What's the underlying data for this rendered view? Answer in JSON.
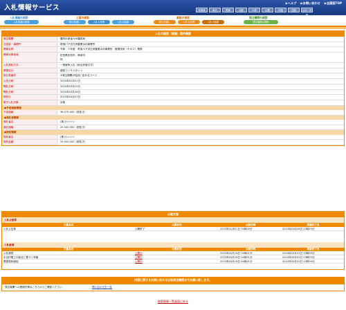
{
  "header": {
    "title": "入札情報サービス",
    "links": [
      "▶ヘルプ",
      "▶お問い合わせ",
      "▶全国版TOP"
    ],
    "regions": [
      "北海道",
      "東北",
      "関東",
      "北陸",
      "中部",
      "近畿",
      "中国",
      "四国",
      "九州・沖縄"
    ]
  },
  "nav": {
    "group_search": "入札情報の検索",
    "group_search_tab": "入札情報の検索",
    "group_work": "工事の検索",
    "work_tabs": [
      "発注見通し",
      "入札公告等",
      "入札の結果"
    ],
    "group_service": "業務の検索",
    "service_tabs": [
      "発注見通し",
      "入札公告等",
      "入札の結果"
    ],
    "group_org": "発注機関の検索",
    "org_tab": "発注機関の検索"
  },
  "detail": {
    "title": "入札の経過（業務）案件概要",
    "rows": [
      {
        "label": "発注機関",
        "value": "農林水産省九州農政局"
      },
      {
        "label": "当該部・事務所",
        "value": "筑後川下流左岸農業水利事業所"
      },
      {
        "label": "業務名称",
        "value": "令和　５年度　筑後川下流左岸農業水利事業所　管理技術（その２）業務"
      },
      {
        "label": "業務対象地域",
        "value": "佐賀県佐賀市、神埼市\n他"
      },
      {
        "label": "入札契約方式",
        "value": "一般競争入札（総合評価方式）"
      },
      {
        "label": "業務区分",
        "value": "建設コンサルタント"
      },
      {
        "label": "設計書番号",
        "value": "※発注機関が独自に定めるコード"
      },
      {
        "label": "公告日時",
        "value": "2023年02月01日"
      },
      {
        "label": "開札日時",
        "value": "2023年03月20日"
      },
      {
        "label": "開札日時",
        "value": "2023年03月28日"
      },
      {
        "label": "契約日",
        "value": "2023年04月07日"
      },
      {
        "label": "電子入札対象",
        "value": "対象"
      }
    ],
    "sec_price": "●予定価格情報",
    "price_label": "予定価格",
    "price_value": "36,070,000（税抜き）",
    "sec_winner": "●落札者情報",
    "winner_name_label": "落札者名",
    "winner_name": "(株)カイハツ",
    "winner_amount_label": "落札価格",
    "winner_amount": "29,500,000（税抜き）",
    "sec_contract": "●契約情報",
    "contractor_label": "契約者名",
    "contractor": "(株)カイハツ",
    "contract_amount_label": "契約金額",
    "contract_amount": "29,500,000（税抜き）"
  },
  "docs": {
    "title": "公開文書",
    "announce_label": "入札公告等",
    "cols": [
      "文書名称",
      "公開状況",
      "公開日時",
      "掲載終了日"
    ],
    "announce_rows": [
      [
        "入札公告等",
        "公開終了",
        "2023年02月01日 00時00分",
        "2023年03月28日 23時59分"
      ]
    ],
    "process_label": "入札経過",
    "process_rows": [
      [
        "入札調書",
        "公開中",
        "2023年04月18日 04時01分",
        "2024年03月31日 23時59分"
      ],
      [
        "手当作業工の総合に基づく資格",
        "公開中",
        "2023年04月18日 04時01分",
        "2024年03月31日 23時59分"
      ],
      [
        "業務契約締結",
        "公開中",
        "2023年04月18日 04時01分",
        "2024年03月31日 23時59分"
      ]
    ]
  },
  "contact": {
    "banner": "内容に関するお問い合わせは各発注機関までお願い致します。",
    "text": "発注機関への連絡先等はこちらからご確認ください。",
    "link": "問い合わせ先一覧"
  },
  "back_link": "検索結果一覧画面に戻る",
  "colors": {
    "accent": "#ef8a00",
    "header": "#1f448f",
    "label_text": "#c00000"
  }
}
